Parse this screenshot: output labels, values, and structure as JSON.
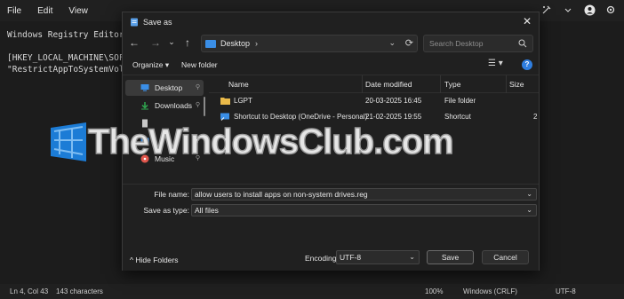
{
  "notepad": {
    "menu": [
      "File",
      "Edit",
      "View"
    ],
    "lines": [
      "Windows Registry Editor Ve",
      "",
      "[HKEY_LOCAL_MACHINE\\SOFTWA",
      "\"RestrictAppToSystemVolume"
    ],
    "status": {
      "position": "Ln 4, Col 43",
      "characters": "143 characters",
      "zoom": "100%",
      "line_endings": "Windows (CRLF)",
      "encoding": "UTF-8"
    }
  },
  "watermark": {
    "text": "TheWindowsClub.com"
  },
  "dialog": {
    "title": "Save as",
    "close_glyph": "✕",
    "nav": {
      "back": "←",
      "forward": "→",
      "dropdown": "⌄",
      "up": "↑"
    },
    "address": {
      "location": "Desktop",
      "separator": "›",
      "dropdown": "⌄",
      "refresh": "⟳"
    },
    "search_placeholder": "Search Desktop",
    "toolbar": {
      "organize": "Organize ▾",
      "new_folder": "New folder",
      "view": "☰ ▾",
      "help": "?"
    },
    "nav_pane": [
      {
        "label": "Desktop",
        "pin": "📌",
        "selected": true,
        "color": "#3a8ee6"
      },
      {
        "label": "Downloads",
        "pin": "📌",
        "selected": false,
        "color": "#2fa84f"
      },
      {
        "label": "",
        "pin": "",
        "selected": false,
        "color": "#c8c8c8"
      },
      {
        "label": "",
        "pin": "📌",
        "selected": false,
        "color": "#3a8ee6"
      },
      {
        "label": "Music",
        "pin": "📌",
        "selected": false,
        "color": "#e0564c"
      }
    ],
    "columns": {
      "name": "Name",
      "date": "Date modified",
      "type": "Type",
      "size": "Size"
    },
    "files": [
      {
        "name": "LGPT",
        "date": "20-03-2025 16:45",
        "type": "File folder",
        "size": "",
        "icon": "folder-icon"
      },
      {
        "name": "Shortcut to Desktop (OneDrive - Personal)",
        "date": "21-02-2025 19:55",
        "type": "Shortcut",
        "size": "2",
        "icon": "shortcut-icon"
      }
    ],
    "fields": {
      "file_name_label": "File name:",
      "file_name_value": "allow users to install apps on non-system drives.reg",
      "save_type_label": "Save as type:",
      "save_type_value": "All files",
      "dropdown_glyph": "⌄"
    },
    "footer": {
      "hide_folders": "^  Hide Folders",
      "encoding_label": "Encoding:",
      "encoding_value": "UTF-8",
      "save": "Save",
      "cancel": "Cancel"
    }
  }
}
